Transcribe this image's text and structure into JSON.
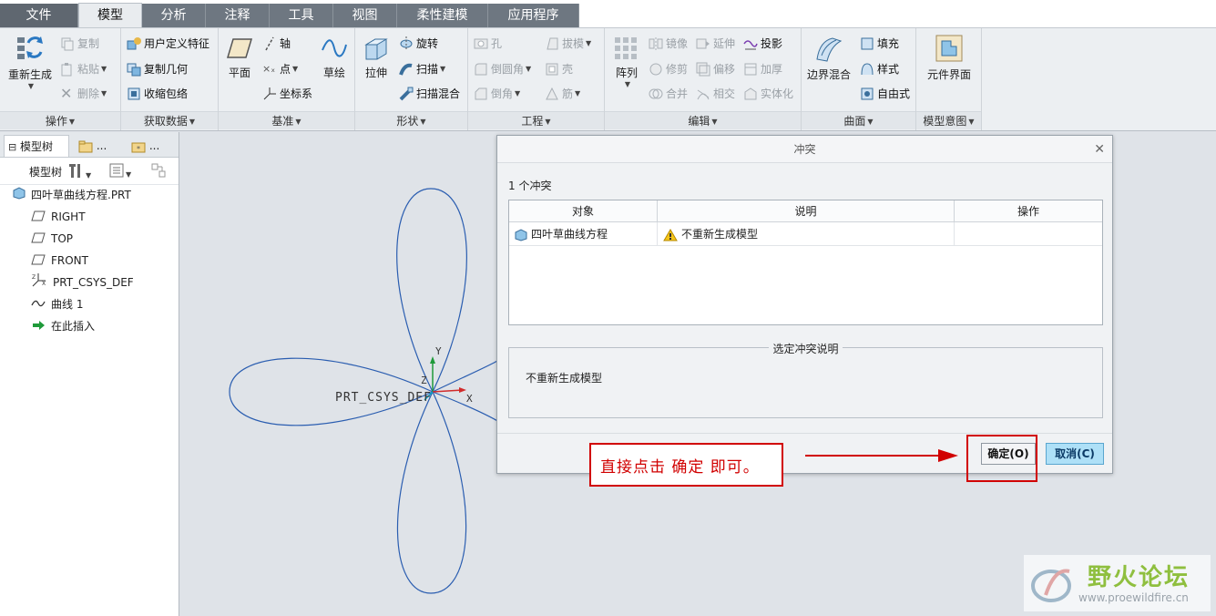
{
  "tabs": [
    "文件",
    "模型",
    "分析",
    "注释",
    "工具",
    "视图",
    "柔性建模",
    "应用程序"
  ],
  "ribbon": {
    "operations": {
      "regenerate": "重新生成",
      "copy": "复制",
      "paste": "粘贴",
      "delete": "删除",
      "label": "操作"
    },
    "get_data": {
      "udf": "用户定义特征",
      "copy_geom": "复制几何",
      "shrinkwrap": "收缩包络",
      "label": "获取数据"
    },
    "datum": {
      "plane": "平面",
      "axis": "轴",
      "point": "点",
      "csys": "坐标系",
      "sketch": "草绘",
      "label": "基准"
    },
    "shapes": {
      "extrude": "拉伸",
      "revolve": "旋转",
      "sweep": "扫描",
      "swept_blend": "扫描混合",
      "label": "形状"
    },
    "engineering": {
      "hole": "孔",
      "round": "倒圆角",
      "chamfer": "倒角",
      "draft": "拔模",
      "shell": "壳",
      "rib": "筋",
      "label": "工程"
    },
    "editing": {
      "pattern": "阵列",
      "mirror": "镜像",
      "trim": "修剪",
      "merge": "合并",
      "extend": "延伸",
      "offset": "偏移",
      "intersect": "相交",
      "project": "投影",
      "thicken": "加厚",
      "solidify": "实体化",
      "label": "编辑"
    },
    "surfaces": {
      "boundary_blend": "边界混合",
      "fill": "填充",
      "style": "样式",
      "freestyle": "自由式",
      "label": "曲面"
    },
    "design_intent": {
      "component_interface": "元件界面",
      "label": "模型意图"
    }
  },
  "left_panel": {
    "tabs": [
      "模型树",
      "...",
      "..."
    ],
    "toolbar_label": "模型树",
    "tree": [
      {
        "label": "四叶草曲线方程.PRT",
        "icon": "part-icon"
      },
      {
        "label": "RIGHT",
        "icon": "datum-plane-icon"
      },
      {
        "label": "TOP",
        "icon": "datum-plane-icon"
      },
      {
        "label": "FRONT",
        "icon": "datum-plane-icon"
      },
      {
        "label": "PRT_CSYS_DEF",
        "icon": "csys-icon"
      },
      {
        "label": "曲线 1",
        "icon": "curve-icon"
      },
      {
        "label": "在此插入",
        "icon": "insert-arrow-icon"
      }
    ]
  },
  "canvas": {
    "csys_label": "PRT_CSYS_DEF",
    "axis_x": "X",
    "axis_y": "Y",
    "axis_z": "Z"
  },
  "dialog": {
    "title": "冲突",
    "count_text": "1 个冲突",
    "columns": [
      "对象",
      "说明",
      "操作"
    ],
    "rows": [
      {
        "object": "四叶草曲线方程",
        "description": "不重新生成模型",
        "action": ""
      }
    ],
    "desc_title": "选定冲突说明",
    "desc_text": "不重新生成模型",
    "ok_label": "确定(O)",
    "cancel_label": "取消(C)"
  },
  "annotation": {
    "text": "直接点击  确定   即可。",
    "color": "#d10000"
  },
  "watermark": {
    "title": "野火论坛",
    "url": "www.proewildfire.cn"
  },
  "colors": {
    "curve": "#2a5db0",
    "accent": "#aee0f7",
    "tab_bg": "#6e7781"
  }
}
